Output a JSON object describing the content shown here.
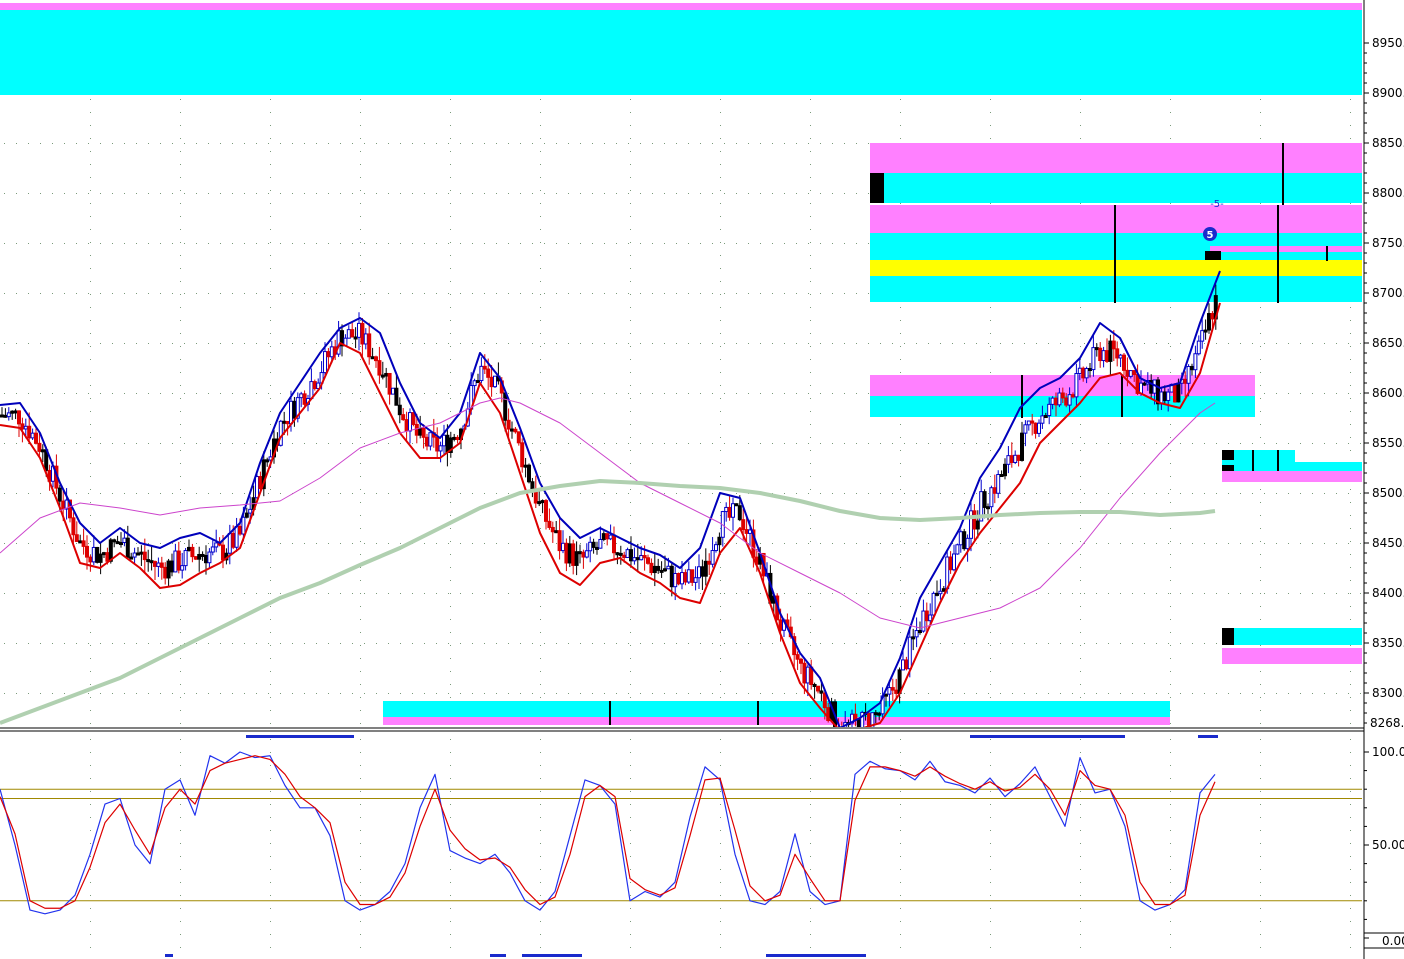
{
  "chart_data": [
    {
      "type": "candlestick",
      "panel": "price",
      "yaxis": {
        "ticks": [
          8950,
          8900,
          8850,
          8800,
          8750,
          8700,
          8650,
          8600,
          8550,
          8500,
          8450,
          8400,
          8350,
          8300
        ],
        "labels": [
          "8950.",
          "8900.",
          "8850.",
          "8800.",
          "8750.",
          "8700.",
          "8650.",
          "8600.",
          "8550.",
          "8500.",
          "8450.",
          "8400.",
          "8350.",
          "8300."
        ],
        "ylim": [
          8268,
          8990
        ],
        "floor_label": "8268.9"
      },
      "grid": true,
      "wave_labels": [
        {
          "text": "5",
          "style": "circled"
        },
        {
          "text": "-5-",
          "style": "plain"
        }
      ],
      "zones": [
        {
          "x0": 0,
          "x1": 1362,
          "y0": 8990,
          "y1": 8983,
          "color": "#ff80ff"
        },
        {
          "x0": 0,
          "x1": 1362,
          "y0": 8983,
          "y1": 8898,
          "color": "#00ffff"
        },
        {
          "x0": 870,
          "x1": 1362,
          "y0": 8850,
          "y1": 8820,
          "color": "#ff80ff"
        },
        {
          "x0": 870,
          "x1": 1362,
          "y0": 8820,
          "y1": 8790,
          "color": "#00ffff"
        },
        {
          "x0": 870,
          "x1": 1362,
          "y0": 8788,
          "y1": 8760,
          "color": "#ff80ff"
        },
        {
          "x0": 870,
          "x1": 1362,
          "y0": 8760,
          "y1": 8733,
          "color": "#00ffff"
        },
        {
          "x0": 870,
          "x1": 1362,
          "y0": 8733,
          "y1": 8717,
          "color": "#ffff00"
        },
        {
          "x0": 870,
          "x1": 1362,
          "y0": 8717,
          "y1": 8691,
          "color": "#00ffff"
        },
        {
          "x0": 1210,
          "x1": 1362,
          "y0": 8747,
          "y1": 8741,
          "color": "#ff80ff"
        },
        {
          "x0": 870,
          "x1": 1255,
          "y0": 8618,
          "y1": 8597,
          "color": "#ff80ff"
        },
        {
          "x0": 870,
          "x1": 1255,
          "y0": 8597,
          "y1": 8576,
          "color": "#00ffff"
        },
        {
          "x0": 1222,
          "x1": 1295,
          "y0": 8543,
          "y1": 8527,
          "color": "#00ffff"
        },
        {
          "x0": 1222,
          "x1": 1362,
          "y0": 8531,
          "y1": 8522,
          "color": "#00ffff"
        },
        {
          "x0": 1222,
          "x1": 1362,
          "y0": 8522,
          "y1": 8511,
          "color": "#ff80ff"
        },
        {
          "x0": 1222,
          "x1": 1362,
          "y0": 8365,
          "y1": 8348,
          "color": "#00ffff"
        },
        {
          "x0": 1222,
          "x1": 1362,
          "y0": 8345,
          "y1": 8329,
          "color": "#ff80ff"
        },
        {
          "x0": 383,
          "x1": 1170,
          "y0": 8292,
          "y1": 8276,
          "color": "#00ffff"
        },
        {
          "x0": 383,
          "x1": 1170,
          "y0": 8276,
          "y1": 8268,
          "color": "#ff80ff"
        }
      ],
      "markers": [
        {
          "x": 870,
          "y0": 8820,
          "y1": 8790,
          "color": "#000000",
          "w": 14
        },
        {
          "x": 1222,
          "y0": 8543,
          "y1": 8533,
          "color": "#000000",
          "w": 12
        },
        {
          "x": 1222,
          "y0": 8528,
          "y1": 8522,
          "color": "#000000",
          "w": 12
        },
        {
          "x": 1222,
          "y0": 8365,
          "y1": 8348,
          "color": "#000000",
          "w": 12
        },
        {
          "x": 1205,
          "y0": 8742,
          "y1": 8733,
          "color": "#000000",
          "w": 16
        }
      ],
      "vlines": [
        {
          "x": 1115,
          "y0": 8788,
          "y1": 8690
        },
        {
          "x": 1278,
          "y0": 8788,
          "y1": 8690
        },
        {
          "x": 1283,
          "y0": 8850,
          "y1": 8788
        },
        {
          "x": 1327,
          "y0": 8747,
          "y1": 8732
        },
        {
          "x": 1022,
          "y0": 8618,
          "y1": 8575
        },
        {
          "x": 1122,
          "y0": 8618,
          "y1": 8576
        },
        {
          "x": 1253,
          "y0": 8543,
          "y1": 8522
        },
        {
          "x": 1278,
          "y0": 8543,
          "y1": 8522
        },
        {
          "x": 610,
          "y0": 8292,
          "y1": 8268
        },
        {
          "x": 758,
          "y0": 8292,
          "y1": 8268
        }
      ],
      "series": [
        {
          "name": "",
          "role": "ma_fast",
          "color": "#0000bb",
          "width": 2,
          "x": [
            0,
            20,
            40,
            60,
            80,
            100,
            120,
            140,
            160,
            180,
            200,
            220,
            240,
            260,
            280,
            300,
            320,
            340,
            360,
            380,
            400,
            420,
            440,
            460,
            480,
            500,
            520,
            540,
            560,
            580,
            600,
            620,
            640,
            660,
            680,
            700,
            720,
            740,
            760,
            780,
            800,
            820,
            840,
            860,
            880,
            900,
            920,
            940,
            960,
            980,
            1000,
            1020,
            1040,
            1060,
            1080,
            1100,
            1120,
            1140,
            1160,
            1180,
            1200,
            1220
          ],
          "values": [
            8588,
            8590,
            8560,
            8510,
            8470,
            8450,
            8465,
            8450,
            8445,
            8455,
            8460,
            8450,
            8470,
            8530,
            8580,
            8610,
            8640,
            8665,
            8675,
            8660,
            8610,
            8570,
            8555,
            8580,
            8640,
            8615,
            8565,
            8510,
            8475,
            8455,
            8465,
            8455,
            8445,
            8438,
            8425,
            8445,
            8500,
            8495,
            8440,
            8380,
            8340,
            8315,
            8265,
            8275,
            8290,
            8335,
            8395,
            8430,
            8465,
            8515,
            8545,
            8585,
            8605,
            8615,
            8635,
            8670,
            8655,
            8615,
            8605,
            8610,
            8670,
            8722
          ]
        },
        {
          "name": "",
          "role": "ma_slow",
          "color": "#dd0000",
          "width": 2,
          "x": [
            0,
            20,
            40,
            60,
            80,
            100,
            120,
            140,
            160,
            180,
            200,
            220,
            240,
            260,
            280,
            300,
            320,
            340,
            360,
            380,
            400,
            420,
            440,
            460,
            480,
            500,
            520,
            540,
            560,
            580,
            600,
            620,
            640,
            660,
            680,
            700,
            720,
            740,
            760,
            780,
            800,
            820,
            840,
            860,
            880,
            900,
            920,
            940,
            960,
            980,
            1000,
            1020,
            1040,
            1060,
            1080,
            1100,
            1120,
            1140,
            1160,
            1180,
            1200,
            1220
          ],
          "values": [
            8568,
            8565,
            8535,
            8485,
            8430,
            8425,
            8440,
            8425,
            8405,
            8408,
            8420,
            8430,
            8445,
            8500,
            8555,
            8580,
            8605,
            8650,
            8640,
            8600,
            8560,
            8535,
            8535,
            8550,
            8610,
            8580,
            8520,
            8460,
            8420,
            8408,
            8430,
            8435,
            8420,
            8410,
            8395,
            8390,
            8440,
            8465,
            8420,
            8360,
            8310,
            8285,
            8262,
            8264,
            8270,
            8300,
            8345,
            8390,
            8430,
            8460,
            8485,
            8510,
            8550,
            8570,
            8590,
            8615,
            8620,
            8600,
            8590,
            8585,
            8620,
            8690
          ]
        },
        {
          "name": "",
          "role": "ma_mid",
          "color": "#cc44cc",
          "width": 1,
          "x": [
            0,
            40,
            80,
            120,
            160,
            200,
            240,
            280,
            320,
            360,
            400,
            440,
            480,
            500,
            520,
            560,
            600,
            640,
            680,
            720,
            760,
            800,
            840,
            880,
            920,
            960,
            1000,
            1040,
            1080,
            1120,
            1160,
            1200,
            1215
          ],
          "values": [
            8440,
            8475,
            8490,
            8485,
            8478,
            8485,
            8488,
            8492,
            8515,
            8545,
            8560,
            8570,
            8590,
            8595,
            8590,
            8570,
            8540,
            8510,
            8490,
            8470,
            8440,
            8420,
            8400,
            8375,
            8365,
            8375,
            8385,
            8405,
            8445,
            8495,
            8540,
            8580,
            8590
          ]
        },
        {
          "name": "",
          "role": "ma_long",
          "color": "#b0d0b0",
          "width": 4,
          "x": [
            0,
            40,
            80,
            120,
            160,
            200,
            240,
            280,
            320,
            360,
            400,
            440,
            480,
            520,
            560,
            600,
            640,
            680,
            720,
            760,
            800,
            840,
            880,
            920,
            960,
            1000,
            1040,
            1080,
            1120,
            1160,
            1200,
            1215
          ],
          "values": [
            8270,
            8285,
            8300,
            8315,
            8335,
            8355,
            8375,
            8395,
            8410,
            8428,
            8445,
            8465,
            8485,
            8500,
            8507,
            8512,
            8510,
            8507,
            8505,
            8500,
            8492,
            8482,
            8475,
            8473,
            8475,
            8478,
            8480,
            8481,
            8481,
            8478,
            8480,
            8482
          ]
        }
      ]
    },
    {
      "type": "line",
      "panel": "stochastic",
      "yaxis": {
        "ticks": [
          100,
          50,
          0
        ],
        "labels": [
          "100.0",
          "50.00",
          "0.00"
        ],
        "ylim": [
          -2,
          110
        ]
      },
      "reference_lines": [
        80,
        75,
        20
      ],
      "series": [
        {
          "name": "",
          "role": "%K",
          "color": "#2233ee",
          "x": [
            0,
            15,
            30,
            45,
            60,
            75,
            90,
            105,
            120,
            135,
            150,
            165,
            180,
            195,
            210,
            225,
            240,
            255,
            270,
            285,
            300,
            315,
            330,
            345,
            360,
            375,
            390,
            405,
            420,
            435,
            450,
            465,
            480,
            495,
            510,
            525,
            540,
            555,
            570,
            585,
            600,
            615,
            630,
            645,
            660,
            675,
            690,
            705,
            720,
            735,
            750,
            765,
            780,
            795,
            810,
            825,
            840,
            855,
            870,
            885,
            900,
            915,
            930,
            945,
            960,
            975,
            990,
            1005,
            1020,
            1035,
            1050,
            1065,
            1080,
            1095,
            1110,
            1125,
            1140,
            1155,
            1170,
            1185,
            1200,
            1215
          ],
          "values": [
            80,
            50,
            15,
            13,
            15,
            23,
            45,
            72,
            75,
            50,
            40,
            80,
            85,
            66,
            98,
            94,
            100,
            97,
            98,
            82,
            70,
            70,
            55,
            20,
            15,
            18,
            25,
            40,
            70,
            88,
            47,
            43,
            40,
            45,
            35,
            20,
            15,
            25,
            55,
            85,
            82,
            72,
            20,
            25,
            22,
            30,
            65,
            92,
            85,
            45,
            20,
            18,
            25,
            56,
            25,
            18,
            20,
            88,
            95,
            91,
            90,
            85,
            95,
            84,
            82,
            78,
            86,
            76,
            83,
            92,
            76,
            60,
            97,
            78,
            80,
            60,
            20,
            15,
            18,
            26,
            78,
            88
          ]
        },
        {
          "name": "",
          "role": "%D",
          "color": "#dd0000",
          "x": [
            0,
            15,
            30,
            45,
            60,
            75,
            90,
            105,
            120,
            135,
            150,
            165,
            180,
            195,
            210,
            225,
            240,
            255,
            270,
            285,
            300,
            315,
            330,
            345,
            360,
            375,
            390,
            405,
            420,
            435,
            450,
            465,
            480,
            495,
            510,
            525,
            540,
            555,
            570,
            585,
            600,
            615,
            630,
            645,
            660,
            675,
            690,
            705,
            720,
            735,
            750,
            765,
            780,
            795,
            810,
            825,
            840,
            855,
            870,
            885,
            900,
            915,
            930,
            945,
            960,
            975,
            990,
            1005,
            1020,
            1035,
            1050,
            1065,
            1080,
            1095,
            1110,
            1125,
            1140,
            1155,
            1170,
            1185,
            1200,
            1215
          ],
          "values": [
            76,
            56,
            20,
            16,
            16,
            20,
            38,
            62,
            72,
            58,
            45,
            70,
            80,
            72,
            90,
            94,
            96,
            98,
            96,
            88,
            76,
            70,
            62,
            30,
            18,
            18,
            22,
            35,
            60,
            80,
            58,
            48,
            42,
            43,
            38,
            26,
            18,
            22,
            45,
            76,
            82,
            76,
            32,
            26,
            23,
            27,
            55,
            85,
            86,
            58,
            28,
            20,
            23,
            45,
            32,
            20,
            20,
            74,
            92,
            92,
            90,
            87,
            92,
            87,
            83,
            80,
            84,
            79,
            81,
            88,
            80,
            66,
            90,
            82,
            80,
            66,
            30,
            18,
            18,
            23,
            66,
            84
          ]
        }
      ]
    }
  ],
  "highlight_bars": [
    {
      "x0": 246,
      "x1": 354,
      "pos": "top"
    },
    {
      "x0": 970,
      "x1": 1125,
      "pos": "top"
    },
    {
      "x0": 1198,
      "x1": 1218,
      "pos": "top"
    },
    {
      "x0": 165,
      "x1": 173,
      "pos": "bottom"
    },
    {
      "x0": 490,
      "x1": 506,
      "pos": "bottom"
    },
    {
      "x0": 522,
      "x1": 582,
      "pos": "bottom"
    },
    {
      "x0": 766,
      "x1": 866,
      "pos": "bottom"
    }
  ],
  "colors": {
    "up": "#0000cc",
    "down": "#dd0000",
    "flat": "#000000",
    "grid": "#7a9a7a",
    "ref": "#a08800"
  }
}
